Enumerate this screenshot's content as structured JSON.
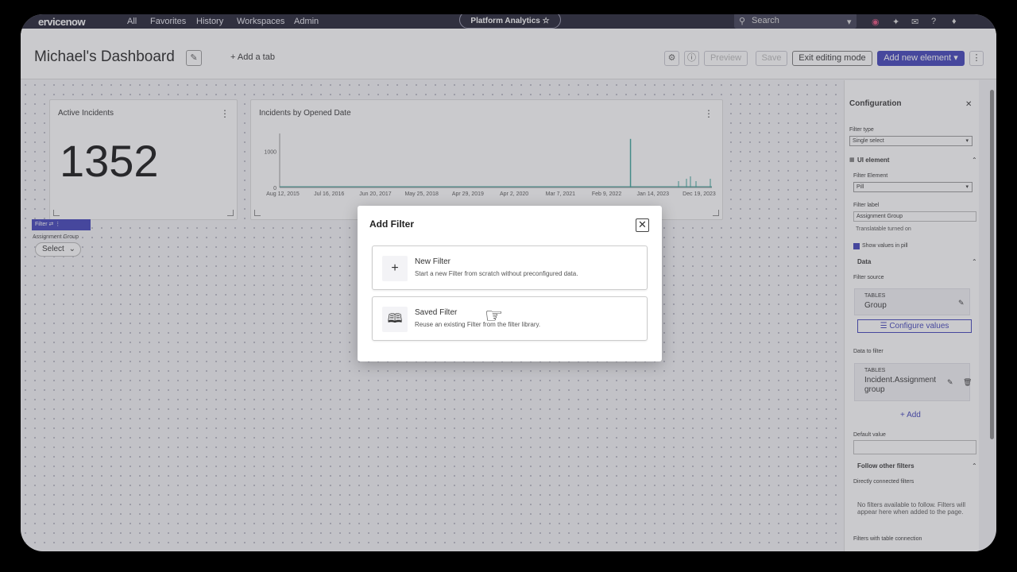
{
  "nav": {
    "logo": "ervicenow",
    "links": [
      "All",
      "Favorites",
      "History",
      "Workspaces",
      "Admin"
    ],
    "pill": "Platform Analytics ☆",
    "search_placeholder": "Search"
  },
  "header": {
    "title": "Michael's Dashboard",
    "add_tab": "+ Add a tab",
    "buttons": {
      "preview": "Preview",
      "save": "Save",
      "exit": "Exit editing mode",
      "add_new": "Add new element ▾"
    }
  },
  "cards": {
    "active": {
      "title": "Active Incidents",
      "value": "1352"
    },
    "chart": {
      "title": "Incidents by Opened Date"
    }
  },
  "chart_data": {
    "type": "bar",
    "title": "Incidents by Opened Date",
    "y_ticks": [
      "1000",
      "0"
    ],
    "x_ticks": [
      "Aug 12, 2015",
      "Jul 16, 2016",
      "Jun 20, 2017",
      "May 25, 2018",
      "Apr 29, 2019",
      "Apr 2, 2020",
      "Mar 7, 2021",
      "Feb 9, 2022",
      "Jan 14, 2023",
      "Dec 19, 2023"
    ],
    "ylim": [
      0,
      1500
    ],
    "spikes": [
      {
        "x": "Feb 9, 2022",
        "value": 1350
      }
    ],
    "color": "#3aa39a"
  },
  "filter_widget": {
    "bar": "Filter  ⇄  ⋮",
    "label": "Assignment Group",
    "select": "Select"
  },
  "config": {
    "title": "Configuration",
    "filter_type_label": "Filter type",
    "filter_type_value": "Single select",
    "ui_element": "UI element",
    "filter_element_label": "Filter Element",
    "filter_element_value": "Pill",
    "filter_label_label": "Filter label",
    "filter_label_value": "Assignment Group",
    "translatable": "Translatable turned on",
    "show_values": "Show values in pill",
    "data": "Data",
    "filter_source": "Filter source",
    "src_tables": "TABLES",
    "src_value": "Group",
    "configure_values": "☰ Configure values",
    "data_to_filter": "Data to filter",
    "dtf_tables": "TABLES",
    "dtf_value_1": "Incident.Assignment",
    "dtf_value_2": "group",
    "add": "+ Add",
    "default_value": "Default value",
    "follow_other": "Follow other filters",
    "directly_connected": "Directly connected filters",
    "no_filters": "No filters available to follow. Filters will appear here when added to the page.",
    "with_table": "Filters with table connection"
  },
  "modal": {
    "title": "Add Filter",
    "options": [
      {
        "icon": "+",
        "title": "New Filter",
        "desc": "Start a new Filter from scratch without preconfigured data."
      },
      {
        "icon": "🕮",
        "title": "Saved Filter",
        "desc": "Reuse an existing Filter from the filter library."
      }
    ]
  }
}
